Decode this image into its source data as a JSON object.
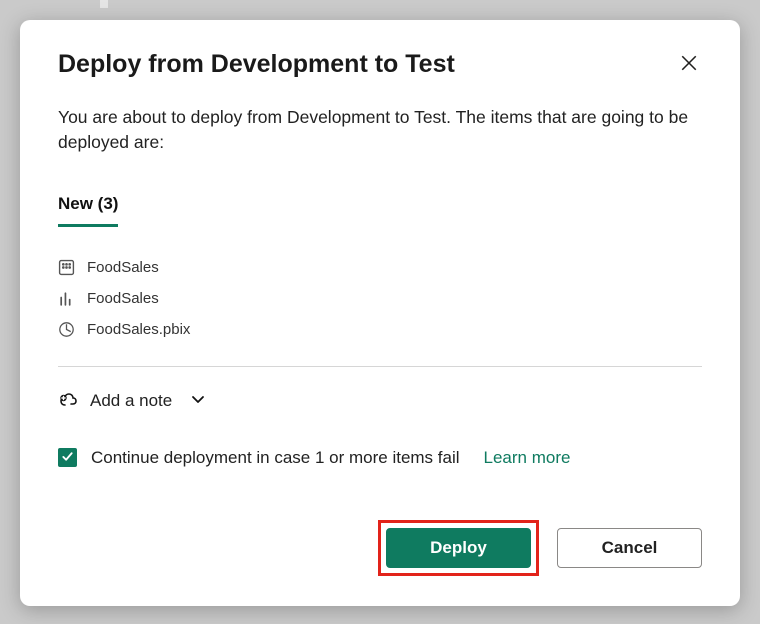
{
  "dialog": {
    "title": "Deploy from Development to Test",
    "description": "You are about to deploy from Development to Test. The items that are going to be deployed are:",
    "tab_label": "New (3)",
    "items": [
      {
        "icon": "dataset",
        "name": "FoodSales"
      },
      {
        "icon": "report",
        "name": "FoodSales"
      },
      {
        "icon": "pbix",
        "name": "FoodSales.pbix"
      }
    ],
    "add_note_label": "Add a note",
    "continue_label": "Continue deployment in case 1 or more items fail",
    "learn_more_label": "Learn more",
    "deploy_label": "Deploy",
    "cancel_label": "Cancel"
  }
}
